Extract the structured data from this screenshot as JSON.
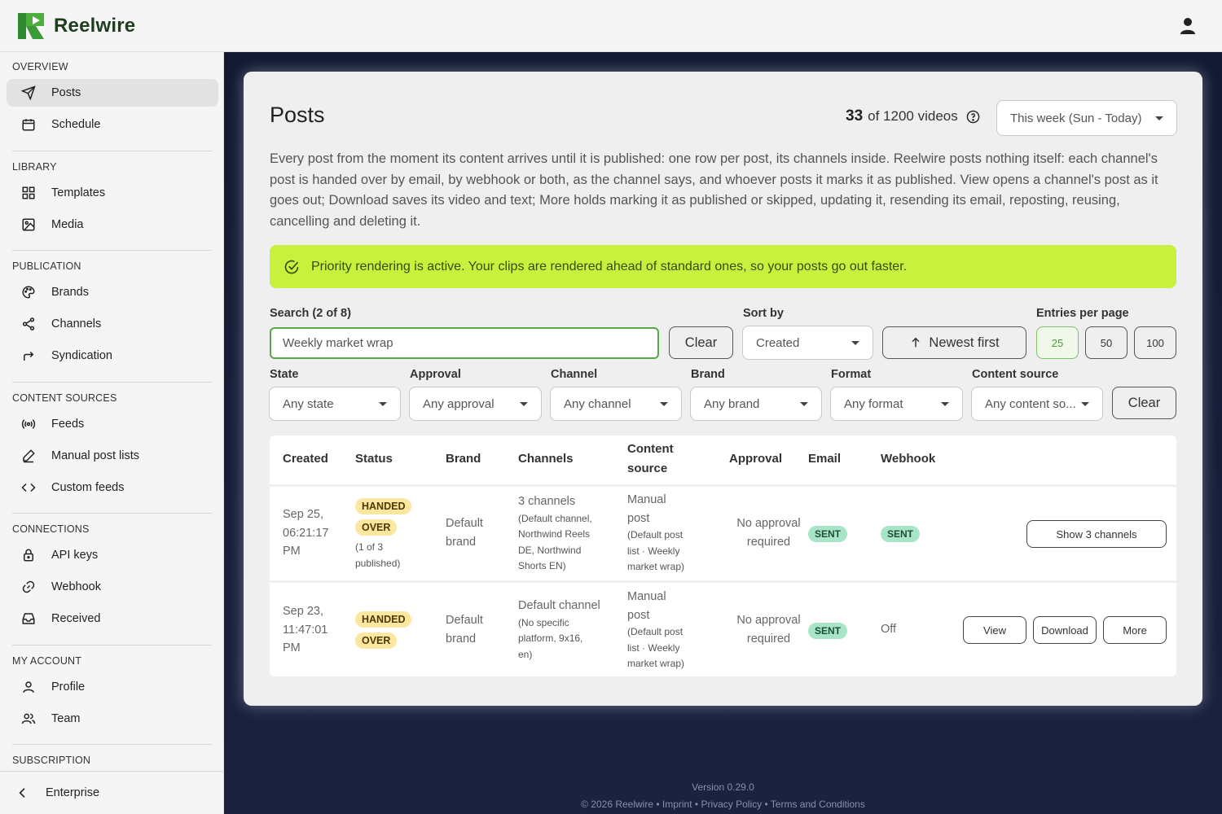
{
  "app": {
    "name": "Reelwire"
  },
  "sidebar": {
    "sections": [
      {
        "title": "OVERVIEW",
        "items": [
          {
            "label": "Posts",
            "icon": "send-icon"
          },
          {
            "label": "Schedule",
            "icon": "calendar-icon"
          }
        ]
      },
      {
        "title": "LIBRARY",
        "items": [
          {
            "label": "Templates",
            "icon": "grid-icon"
          },
          {
            "label": "Media",
            "icon": "image-icon"
          }
        ]
      },
      {
        "title": "PUBLICATION",
        "items": [
          {
            "label": "Brands",
            "icon": "palette-icon"
          },
          {
            "label": "Channels",
            "icon": "share-icon"
          },
          {
            "label": "Syndication",
            "icon": "forward-arrow-icon"
          }
        ]
      },
      {
        "title": "CONTENT SOURCES",
        "items": [
          {
            "label": "Feeds",
            "icon": "broadcast-icon"
          },
          {
            "label": "Manual post lists",
            "icon": "pencil-icon"
          },
          {
            "label": "Custom feeds",
            "icon": "code-icon"
          }
        ]
      },
      {
        "title": "CONNECTIONS",
        "items": [
          {
            "label": "API keys",
            "icon": "lock-icon"
          },
          {
            "label": "Webhook",
            "icon": "link-icon"
          },
          {
            "label": "Received",
            "icon": "inbox-icon"
          }
        ]
      },
      {
        "title": "MY ACCOUNT",
        "items": [
          {
            "label": "Profile",
            "icon": "person-icon"
          },
          {
            "label": "Team",
            "icon": "people-icon"
          }
        ]
      },
      {
        "title": "SUBSCRIPTION",
        "items": []
      }
    ],
    "bottom": {
      "label": "Enterprise"
    }
  },
  "page": {
    "title": "Posts",
    "count": {
      "shown": "33",
      "text": "of 1200 videos"
    },
    "period": "This week (Sun - Today)",
    "description": "Every post from the moment its content arrives until it is published: one row per post, its channels inside. Reelwire posts nothing itself: each channel's post is handed over by email, by webhook or both, as the channel says, and whoever posts it marks it as published. View opens a channel's post as it goes out; Download saves its video and text; More holds marking it as published or skipped, updating it, resending its email, reposting, reusing, cancelling and deleting it.",
    "banner": "Priority rendering is active. Your clips are rendered ahead of standard ones, so your posts go out faster."
  },
  "filters": {
    "search_label": "Search (2 of 8)",
    "search_value": "Weekly market wrap",
    "clear": "Clear",
    "sort_label": "Sort by",
    "sort_value": "Created",
    "order": "Newest first",
    "entries_label": "Entries per page",
    "entries": [
      "25",
      "50",
      "100"
    ],
    "state_label": "State",
    "state_value": "Any state",
    "approval_label": "Approval",
    "approval_value": "Any approval",
    "channel_label": "Channel",
    "channel_value": "Any channel",
    "brand_label": "Brand",
    "brand_value": "Any brand",
    "format_label": "Format",
    "format_value": "Any format",
    "source_label": "Content source",
    "source_value": "Any content so...",
    "clear2": "Clear"
  },
  "table": {
    "headers": {
      "created": "Created",
      "status": "Status",
      "brand": "Brand",
      "channels": "Channels",
      "source_1": "Content",
      "source_2": "source",
      "approval": "Approval",
      "email": "Email",
      "webhook": "Webhook"
    },
    "rows": [
      {
        "created": [
          "Sep 25,",
          "06:21:17",
          "PM"
        ],
        "status": [
          "HANDED",
          "OVER"
        ],
        "status_note": [
          "(1 of 3",
          "published)"
        ],
        "brand": [
          "Default",
          "brand"
        ],
        "channels_main": "3 channels",
        "channels_note": [
          "(Default channel,",
          "Northwind Reels",
          "DE, Northwind",
          "Shorts EN)"
        ],
        "source_main": [
          "Manual",
          "post"
        ],
        "source_note": [
          "(Default post",
          "list · Weekly",
          "market wrap)"
        ],
        "approval": [
          "No approval",
          "required"
        ],
        "email": "SENT",
        "webhook": "SENT",
        "action": "Show 3 channels"
      },
      {
        "created": [
          "Sep 23,",
          "11:47:01",
          "PM"
        ],
        "status": [
          "HANDED",
          "OVER"
        ],
        "brand": [
          "Default",
          "brand"
        ],
        "channels_main": "Default channel",
        "channels_note": [
          "(No specific",
          "platform, 9x16,",
          "en)"
        ],
        "source_main": [
          "Manual",
          "post"
        ],
        "source_note": [
          "(Default post",
          "list · Weekly",
          "market wrap)"
        ],
        "approval": [
          "No approval",
          "required"
        ],
        "email": "SENT",
        "webhook": "Off",
        "actions": [
          "View",
          "Download",
          "More"
        ]
      }
    ]
  },
  "footer": {
    "version": "Version 0.29.0",
    "copyright": "© 2026 Reelwire",
    "links": [
      "Imprint",
      "Privacy Policy",
      "Terms and Conditions"
    ],
    "line2": "© 2026 Reelwire • Imprint • Privacy Policy • Terms and Conditions"
  },
  "colors": {
    "accent": "#5aa64a",
    "banner": "#c7f13c",
    "sent": "#a8e5c8",
    "handed": "#fde6a0",
    "background": "#121a33"
  }
}
